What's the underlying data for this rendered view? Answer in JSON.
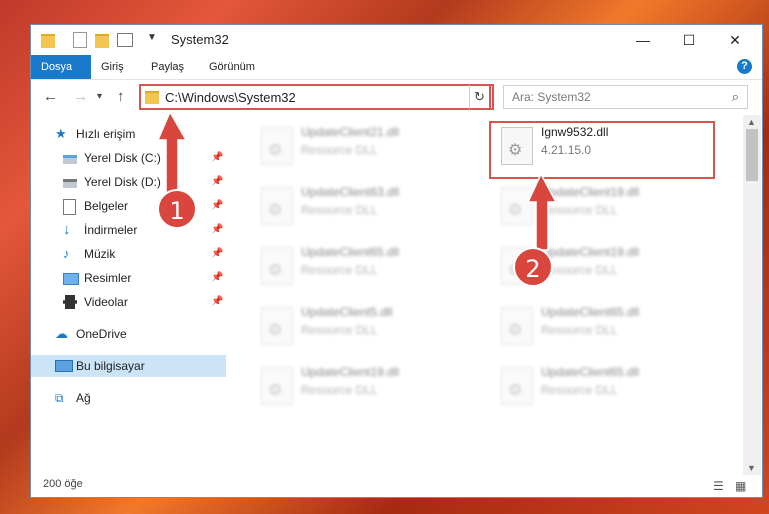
{
  "window": {
    "title": "System32",
    "controls": {
      "minimize": "—",
      "maximize": "☐",
      "close": "✕"
    }
  },
  "ribbon": {
    "tabs": [
      "Dosya",
      "Giriş",
      "Paylaş",
      "Görünüm"
    ],
    "active_tab": "Dosya",
    "help": "?"
  },
  "nav": {
    "back": "←",
    "forward": "→",
    "recent": "▾",
    "up": "↑",
    "address": "C:\\Windows\\System32",
    "dropdown": "⌄",
    "refresh": "↻",
    "search_placeholder": "Ara: System32",
    "search_icon": "⌕"
  },
  "sidebar": {
    "quick_access": "Hızlı erişim",
    "items": [
      {
        "label": "Yerel Disk (C:)",
        "icon": "drive-icon"
      },
      {
        "label": "Yerel Disk (D:)",
        "icon": "drive-icon"
      },
      {
        "label": "Belgeler",
        "icon": "documents-icon"
      },
      {
        "label": "İndirmeler",
        "icon": "downloads-icon"
      },
      {
        "label": "Müzik",
        "icon": "music-icon"
      },
      {
        "label": "Resimler",
        "icon": "pictures-icon"
      },
      {
        "label": "Videolar",
        "icon": "videos-icon"
      }
    ],
    "onedrive": "OneDrive",
    "this_pc": "Bu bilgisayar",
    "network": "Ağ"
  },
  "files": {
    "left_column": [
      {
        "name": "UpdateClient21.dll",
        "desc": "Resource DLL"
      },
      {
        "name": "UpdateClient63.dll",
        "desc": "Resource DLL"
      },
      {
        "name": "UpdateClient65.dll",
        "desc": "Resource DLL"
      },
      {
        "name": "UpdateClient5.dll",
        "desc": "Resource DLL"
      },
      {
        "name": "UpdateClient19.dll",
        "desc": "Resource DLL"
      }
    ],
    "right_column": [
      {
        "name": "Ignw9532.dll",
        "desc": "4.21.15.0"
      },
      {
        "name": "UpdateClient19.dll",
        "desc": "Resource DLL"
      },
      {
        "name": "UpdateClient19.dll",
        "desc": "Resource DLL"
      },
      {
        "name": "UpdateClient65.dll",
        "desc": "Resource DLL"
      },
      {
        "name": "UpdateClient65.dll",
        "desc": "Resource DLL"
      }
    ]
  },
  "status": {
    "item_count": "200 öğe"
  },
  "callouts": {
    "one": "1",
    "two": "2"
  },
  "colors": {
    "accent": "#1979ca",
    "highlight": "#d9534f",
    "callout": "#d9463e"
  }
}
